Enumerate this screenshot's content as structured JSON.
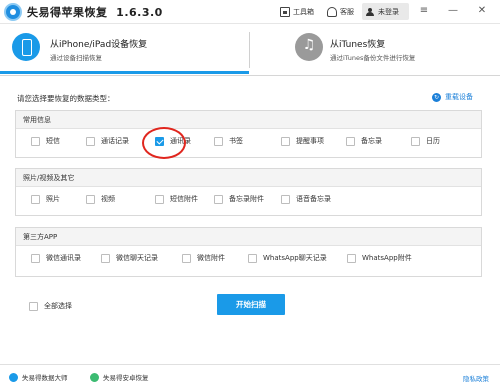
{
  "app": {
    "title": "失易得苹果恢复",
    "version": "1.6.3.0"
  },
  "titlebar": {
    "toolbox_label": "工具箱",
    "service_label": "客服",
    "user_label": "未登录",
    "menu_icon": "menu-icon",
    "minimize_icon": "minimize-icon",
    "close_icon": "close-icon"
  },
  "modes": [
    {
      "title": "从iPhone/iPad设备恢复",
      "subtitle": "通过设备扫描恢复",
      "icon": "phone-icon",
      "active": true
    },
    {
      "title": "从iTunes恢复",
      "subtitle": "通过iTunes备份文件进行恢复",
      "icon": "music-icon",
      "active": false
    }
  ],
  "main": {
    "prompt": "请您选择要恢复的数据类型：",
    "reload_label": "重载设备",
    "sections": [
      {
        "title": "常用信息",
        "options": [
          {
            "label": "短信",
            "checked": false
          },
          {
            "label": "通话记录",
            "checked": false
          },
          {
            "label": "通讯录",
            "checked": true
          },
          {
            "label": "书签",
            "checked": false
          },
          {
            "label": "提醒事项",
            "checked": false
          },
          {
            "label": "备忘录",
            "checked": false
          },
          {
            "label": "日历",
            "checked": false
          }
        ]
      },
      {
        "title": "照片/视频及其它",
        "options": [
          {
            "label": "照片",
            "checked": false
          },
          {
            "label": "视频",
            "checked": false
          },
          {
            "label": "短信附件",
            "checked": false
          },
          {
            "label": "备忘录附件",
            "checked": false
          },
          {
            "label": "语音备忘录",
            "checked": false
          }
        ]
      },
      {
        "title": "第三方APP",
        "options": [
          {
            "label": "微信通讯录",
            "checked": false
          },
          {
            "label": "微信聊天记录",
            "checked": false
          },
          {
            "label": "微信附件",
            "checked": false
          },
          {
            "label": "WhatsApp聊天记录",
            "checked": false
          },
          {
            "label": "WhatsApp附件",
            "checked": false
          }
        ]
      }
    ],
    "select_all_label": "全部选择",
    "start_button": "开始扫描"
  },
  "footer": {
    "link1": "失易得数据大师",
    "link2": "失易得安卓恢复",
    "privacy": "隐私政策"
  }
}
